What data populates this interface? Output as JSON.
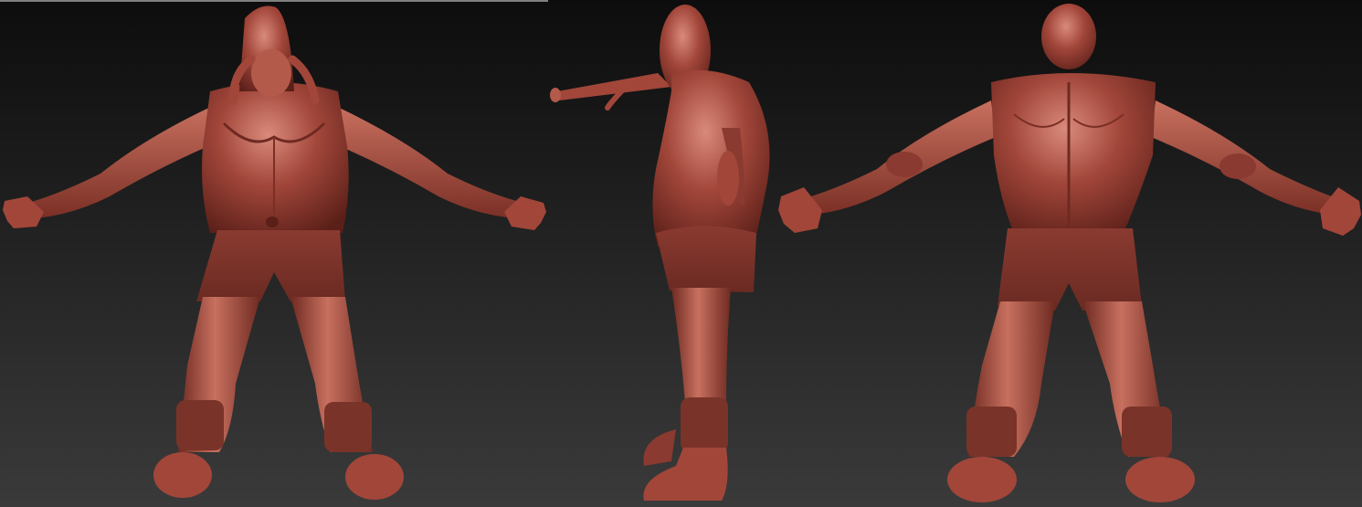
{
  "viewport": {
    "background_top": "#0d0d0d",
    "background_bottom": "#3a3a3a",
    "top_strip_color": "#7f7f7f"
  },
  "material": {
    "base_color": "#a2463a",
    "highlight_color": "#d98a7b",
    "shadow_color": "#5a1f18",
    "shorts_color": "#8a3a30"
  },
  "views": [
    {
      "name": "front-view"
    },
    {
      "name": "side-view"
    },
    {
      "name": "back-view"
    }
  ]
}
